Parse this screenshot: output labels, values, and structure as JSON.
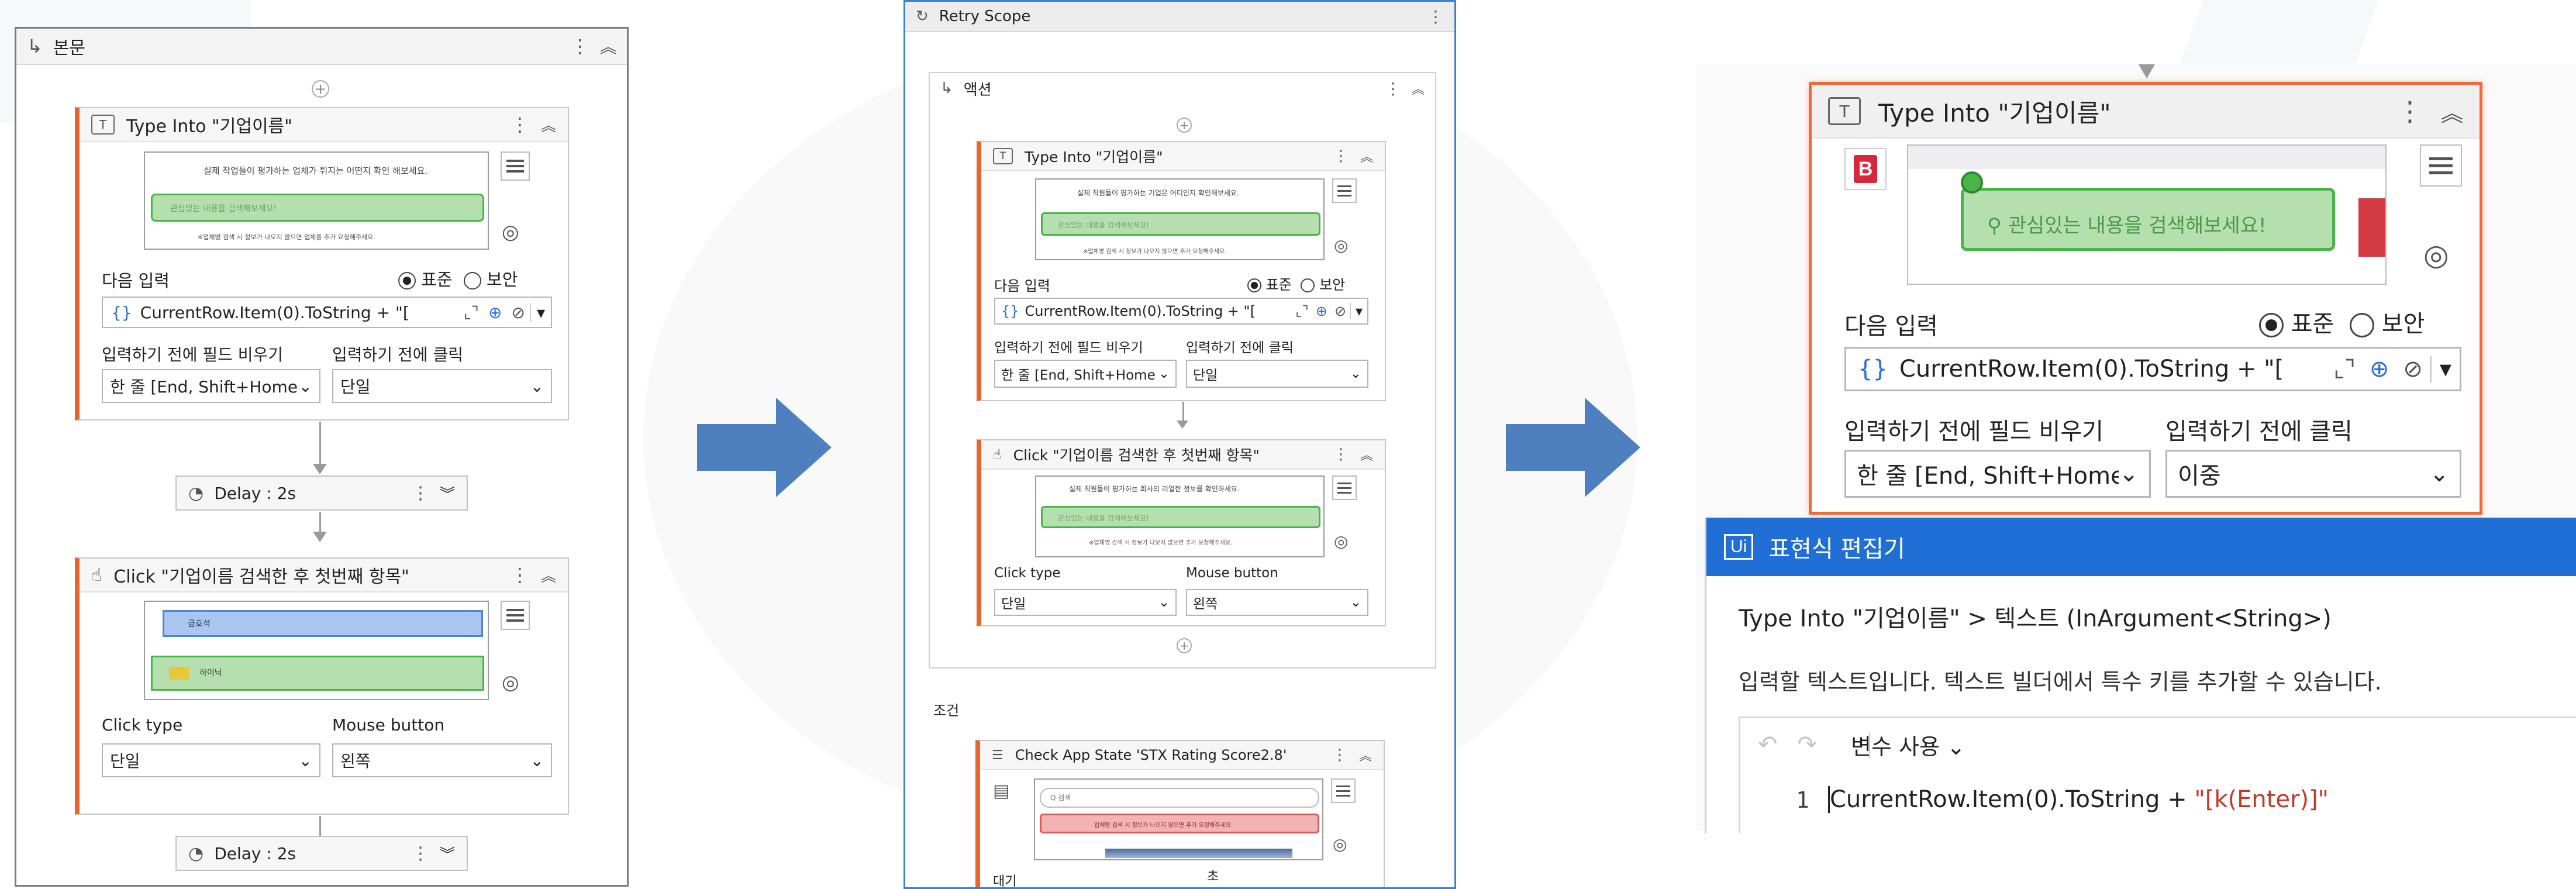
{
  "left": {
    "sequence": {
      "title": "본문",
      "icon": "enter-arrow-icon"
    },
    "type_into": {
      "title": "Type Into \"기업이름\"",
      "preview_text": "실제 작업들이 평가하는 업체가 튀지는 어떤지 확인 해보세요.",
      "preview_search": "관심있는 내용을 검색해보세요!",
      "preview_footer": "※업체명 검색 시 정보가 나오지 않으면 업체를 추가 요청해주세요.",
      "next_input_label": "다음 입력",
      "radio_standard": "표준",
      "radio_secure": "보안",
      "input_value": "CurrentRow.Item(0).ToString + \"[",
      "empty_field_label": "입력하기 전에 필드 비우기",
      "empty_field_value": "한 줄 [End, Shift+Home",
      "click_before_label": "입력하기 전에 클릭",
      "click_before_value": "단일"
    },
    "delay1": {
      "label": "Delay : 2s"
    },
    "click": {
      "title": "Click \"기업이름 검색한 후 첫번째 항목\"",
      "preview_row1": "금호석",
      "preview_row2": "하이닉",
      "click_type_label": "Click type",
      "click_type_value": "단일",
      "mouse_button_label": "Mouse button",
      "mouse_button_value": "왼쪽"
    },
    "delay2": {
      "label": "Delay : 2s"
    }
  },
  "middle": {
    "retry_scope": {
      "title": "Retry Scope"
    },
    "action_section": {
      "title": "액션"
    },
    "type_into": {
      "title": "Type Into \"기업이름\"",
      "preview_text": "실제 직원들이 평가하는 기업은 어디인지 확인해보세요.",
      "preview_search": "관심있는 내용을 검색해보세요!",
      "preview_footer": "※업체명 검색 시 정보가 나오지 않으면 추가 요청해주세요.",
      "next_input_label": "다음 입력",
      "radio_standard": "표준",
      "radio_secure": "보안",
      "input_value": "CurrentRow.Item(0).ToString + \"[",
      "empty_field_label": "입력하기 전에 필드 비우기",
      "empty_field_value": "한 줄 [End, Shift+Home",
      "click_before_label": "입력하기 전에 클릭",
      "click_before_value": "단일"
    },
    "click": {
      "title": "Click \"기업이름 검색한 후 첫번째 항목\"",
      "preview_text": "실제 직원들이 평가하는 회사의 리얼한 정보를 확인하세요.",
      "preview_search": "관심있는 내용을 검색해보세요!",
      "preview_footer": "※업체명 검색 시 정보가 나오지 않으면 추가 요청해주세요.",
      "click_type_label": "Click type",
      "click_type_value": "단일",
      "mouse_button_label": "Mouse button",
      "mouse_button_value": "왼쪽"
    },
    "condition_label": "조건",
    "check_app": {
      "title": "Check App State 'STX Rating Score2.8'",
      "preview_search": "Q 검색",
      "preview_text": "업체명 검색 시 정보가 나오지 않으면 추가 요청해주세요.",
      "bottom_label": "대기",
      "bottom_value": "초"
    }
  },
  "right": {
    "type_into": {
      "title": "Type Into \"기업이름\"",
      "preview_search": "관심있는 내용을 검색해보세요!",
      "next_input_label": "다음 입력",
      "radio_standard": "표준",
      "radio_secure": "보안",
      "input_value": "CurrentRow.Item(0).ToString + \"[",
      "empty_field_label": "입력하기 전에 필드 비우기",
      "empty_field_value": "한 줄 [End, Shift+Home",
      "click_before_label": "입력하기 전에 클릭",
      "click_before_value": "이중"
    },
    "editor": {
      "logo": "Ui",
      "title": "표현식 편집기",
      "breadcrumb": "Type Into \"기업이름\" > 텍스트 (InArgument<String>)",
      "description": "입력할 텍스트입니다. 텍스트 빌더에서 특수 키를 추가할 수 있습니다.",
      "use_variables": "변수 사용",
      "line_number": "1",
      "code_plain": "CurrentRow.Item(0).ToString + ",
      "code_string": "\"[k(Enter)]\""
    }
  },
  "colors": {
    "accent_orange": "#e8652d",
    "flow_arrow": "#4e7fbe",
    "uipath_blue": "#1f6fd6",
    "selection_green": "#48b548",
    "string_red": "#c0392b"
  }
}
